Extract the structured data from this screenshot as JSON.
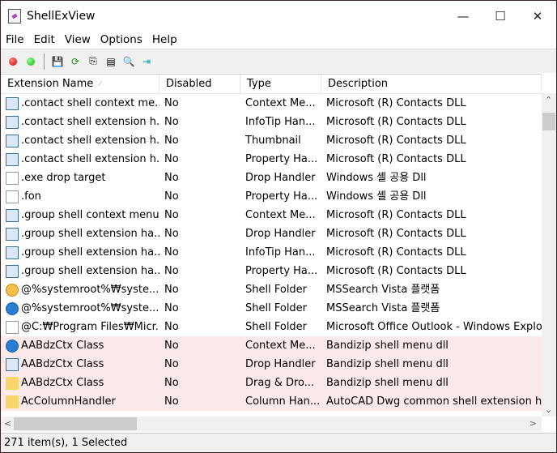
{
  "window": {
    "title": "ShellExView",
    "minimize": "—",
    "maximize": "☐",
    "close": "✕"
  },
  "menu": [
    "File",
    "Edit",
    "View",
    "Options",
    "Help"
  ],
  "toolbar": [
    "disable-selected-icon",
    "enable-selected-icon",
    "save-icon",
    "refresh-icon",
    "copy-icon",
    "properties-icon",
    "find-icon",
    "exit-icon"
  ],
  "columns": [
    "Extension Name",
    "Disabled",
    "Type",
    "Description"
  ],
  "rows": [
    {
      "name": ".contact shell context me...",
      "disabled": "No",
      "type": "Context Me...",
      "desc": "Microsoft (R) Contacts DLL",
      "icon": "contact"
    },
    {
      "name": ".contact shell extension h...",
      "disabled": "No",
      "type": "InfoTip Han...",
      "desc": "Microsoft (R) Contacts DLL",
      "icon": "contact"
    },
    {
      "name": ".contact shell extension h...",
      "disabled": "No",
      "type": "Thumbnail",
      "desc": "Microsoft (R) Contacts DLL",
      "icon": "contact"
    },
    {
      "name": ".contact shell extension h...",
      "disabled": "No",
      "type": "Property Ha...",
      "desc": "Microsoft (R) Contacts DLL",
      "icon": "contact"
    },
    {
      "name": ".exe drop target",
      "disabled": "No",
      "type": "Drop Handler",
      "desc": "Windows 셸 공용 Dll",
      "icon": "file"
    },
    {
      "name": ".fon",
      "disabled": "No",
      "type": "Property Ha...",
      "desc": "Windows 셸 공용 Dll",
      "icon": "file"
    },
    {
      "name": ".group shell context menu",
      "disabled": "No",
      "type": "Context Me...",
      "desc": "Microsoft (R) Contacts DLL",
      "icon": "contact"
    },
    {
      "name": ".group shell extension ha...",
      "disabled": "No",
      "type": "Drop Handler",
      "desc": "Microsoft (R) Contacts DLL",
      "icon": "contact"
    },
    {
      "name": ".group shell extension ha...",
      "disabled": "No",
      "type": "InfoTip Han...",
      "desc": "Microsoft (R) Contacts DLL",
      "icon": "contact"
    },
    {
      "name": ".group shell extension ha...",
      "disabled": "No",
      "type": "Property Ha...",
      "desc": "Microsoft (R) Contacts DLL",
      "icon": "contact"
    },
    {
      "name": "@%systemroot%₩syste...",
      "disabled": "No",
      "type": "Shell Folder",
      "desc": "MSSearch Vista 플랫폼",
      "icon": "orange"
    },
    {
      "name": "@%systemroot%₩syste...",
      "disabled": "No",
      "type": "Shell Folder",
      "desc": "MSSearch Vista 플랫폼",
      "icon": "round"
    },
    {
      "name": "@C:₩Program Files₩Micr...",
      "disabled": "No",
      "type": "Shell Folder",
      "desc": "Microsoft Office Outlook - Windows Explo",
      "icon": "file"
    },
    {
      "name": "AABdzCtx Class",
      "disabled": "No",
      "type": "Context Me...",
      "desc": "Bandizip shell menu dll",
      "icon": "round",
      "sel": true
    },
    {
      "name": "AABdzCtx Class",
      "disabled": "No",
      "type": "Drop Handler",
      "desc": "Bandizip shell menu dll",
      "icon": "contact",
      "sel": true
    },
    {
      "name": "AABdzCtx Class",
      "disabled": "No",
      "type": "Drag & Dro...",
      "desc": "Bandizip shell menu dll",
      "icon": "folder",
      "sel": true
    },
    {
      "name": "AcColumnHandler",
      "disabled": "No",
      "type": "Column Han...",
      "desc": "AutoCAD Dwg common shell extension ha",
      "icon": "folder",
      "sel": true
    }
  ],
  "status": "271 item(s), 1 Selected"
}
